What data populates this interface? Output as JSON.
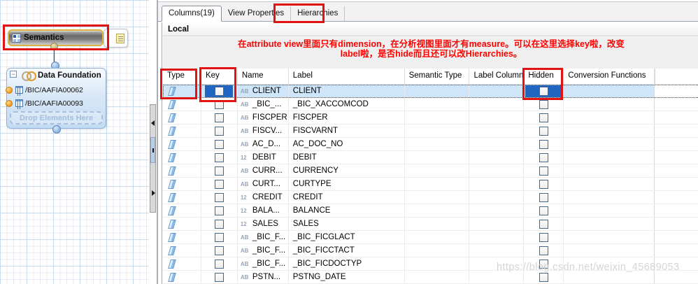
{
  "canvas": {
    "semantics_node": {
      "label": "Semantics"
    },
    "data_foundation": {
      "title": "Data Foundation",
      "collapse_glyph": "−",
      "items": [
        {
          "label": "/BIC/AAFIA00062"
        },
        {
          "label": "/BIC/AAFIA00093"
        }
      ],
      "drop_placeholder": "Drop Elements Here"
    }
  },
  "tabs": [
    {
      "label": "Columns(19)",
      "active": true,
      "annotated": false
    },
    {
      "label": "View Properties",
      "active": false,
      "annotated": false
    },
    {
      "label": "Hierarchies",
      "active": false,
      "annotated": true
    }
  ],
  "panel": {
    "section_label": "Local",
    "annotation_line1": "在attribute view里面只有dimension，在分析视图里面才有measure。可以在这里选择key啦，改变",
    "annotation_line2": "label啦，是否hide而且还可以改Hierarchies。"
  },
  "table": {
    "columns": [
      "Type",
      "Key",
      "Name",
      "Label",
      "Semantic Type",
      "Label Column",
      "Hidden",
      "Conversion Functions"
    ],
    "annotated_columns": [
      "Type",
      "Key",
      "Hidden"
    ],
    "rows": [
      {
        "type_badge": "AB",
        "name": "CLIENT",
        "label": "CLIENT",
        "key_checked": false,
        "hidden_checked": false,
        "selected": true
      },
      {
        "type_badge": "AB",
        "name": "_BIC_...",
        "label": "_BIC_XACCOMCOD",
        "key_checked": false,
        "hidden_checked": false,
        "selected": false
      },
      {
        "type_badge": "AB",
        "name": "FISCPER",
        "label": "FISCPER",
        "key_checked": false,
        "hidden_checked": false,
        "selected": false
      },
      {
        "type_badge": "AB",
        "name": "FISCV...",
        "label": "FISCVARNT",
        "key_checked": false,
        "hidden_checked": false,
        "selected": false
      },
      {
        "type_badge": "AB",
        "name": "AC_D...",
        "label": "AC_DOC_NO",
        "key_checked": false,
        "hidden_checked": false,
        "selected": false
      },
      {
        "type_badge": "12",
        "name": "DEBIT",
        "label": "DEBIT",
        "key_checked": false,
        "hidden_checked": false,
        "selected": false
      },
      {
        "type_badge": "AB",
        "name": "CURR...",
        "label": "CURRENCY",
        "key_checked": false,
        "hidden_checked": false,
        "selected": false
      },
      {
        "type_badge": "AB",
        "name": "CURT...",
        "label": "CURTYPE",
        "key_checked": false,
        "hidden_checked": false,
        "selected": false
      },
      {
        "type_badge": "12",
        "name": "CREDIT",
        "label": "CREDIT",
        "key_checked": false,
        "hidden_checked": false,
        "selected": false
      },
      {
        "type_badge": "12",
        "name": "BALA...",
        "label": "BALANCE",
        "key_checked": false,
        "hidden_checked": false,
        "selected": false
      },
      {
        "type_badge": "12",
        "name": "SALES",
        "label": "SALES",
        "key_checked": false,
        "hidden_checked": false,
        "selected": false
      },
      {
        "type_badge": "AB",
        "name": "_BIC_F...",
        "label": "_BIC_FICGLACT",
        "key_checked": false,
        "hidden_checked": false,
        "selected": false
      },
      {
        "type_badge": "AB",
        "name": "_BIC_F...",
        "label": "_BIC_FICCTACT",
        "key_checked": false,
        "hidden_checked": false,
        "selected": false
      },
      {
        "type_badge": "AB",
        "name": "_BIC_F...",
        "label": "_BIC_FICDOCTYP",
        "key_checked": false,
        "hidden_checked": false,
        "selected": false
      },
      {
        "type_badge": "AB",
        "name": "PSTN...",
        "label": "PSTNG_DATE",
        "key_checked": false,
        "hidden_checked": false,
        "selected": false
      }
    ]
  },
  "watermark": "https://blog.csdn.net/weixin_45689053",
  "colors": {
    "annotation_red": "#e11212",
    "annotation_text_red": "#ff0000",
    "selected_row_bg": "#cfe5f9",
    "selected_cell_bg": "#2065c0",
    "splitter_thumb": "#b9cfe8",
    "node_selection_gold": "#d9b13c",
    "canvas_grid_blue": "#c7daee"
  }
}
